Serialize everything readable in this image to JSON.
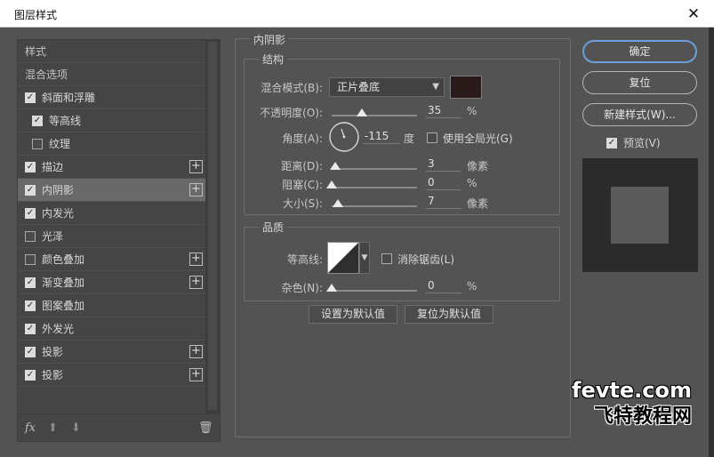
{
  "window": {
    "title": "图层样式",
    "close_glyph": "✕"
  },
  "left_list": {
    "items": [
      {
        "label": "样式",
        "checkbox": null,
        "plus": false,
        "selected": false,
        "indent": false
      },
      {
        "label": "混合选项",
        "checkbox": null,
        "plus": false,
        "selected": false,
        "indent": false
      },
      {
        "label": "斜面和浮雕",
        "checkbox": true,
        "plus": false,
        "selected": false,
        "indent": false
      },
      {
        "label": "等高线",
        "checkbox": true,
        "plus": false,
        "selected": false,
        "indent": true
      },
      {
        "label": "纹理",
        "checkbox": false,
        "plus": false,
        "selected": false,
        "indent": true
      },
      {
        "label": "描边",
        "checkbox": true,
        "plus": true,
        "selected": false,
        "indent": false
      },
      {
        "label": "内阴影",
        "checkbox": true,
        "plus": true,
        "selected": true,
        "indent": false
      },
      {
        "label": "内发光",
        "checkbox": true,
        "plus": false,
        "selected": false,
        "indent": false
      },
      {
        "label": "光泽",
        "checkbox": false,
        "plus": false,
        "selected": false,
        "indent": false
      },
      {
        "label": "颜色叠加",
        "checkbox": false,
        "plus": true,
        "selected": false,
        "indent": false
      },
      {
        "label": "渐变叠加",
        "checkbox": true,
        "plus": true,
        "selected": false,
        "indent": false
      },
      {
        "label": "图案叠加",
        "checkbox": true,
        "plus": false,
        "selected": false,
        "indent": false
      },
      {
        "label": "外发光",
        "checkbox": true,
        "plus": false,
        "selected": false,
        "indent": false
      },
      {
        "label": "投影",
        "checkbox": true,
        "plus": true,
        "selected": false,
        "indent": false
      },
      {
        "label": "投影",
        "checkbox": true,
        "plus": true,
        "selected": false,
        "indent": false
      }
    ],
    "tools": {
      "fx": "fx",
      "up": "⬆",
      "down": "⬇",
      "trash": "🗑"
    }
  },
  "inner_shadow": {
    "group_title": "内阴影",
    "structure": {
      "title": "结构",
      "blend_mode_label": "混合模式(B):",
      "blend_mode_value": "正片叠底",
      "blend_color": "#2b1a1a",
      "opacity_label": "不透明度(O):",
      "opacity_value": "35",
      "opacity_fraction": 0.35,
      "opacity_unit": "%",
      "angle_label": "角度(A):",
      "angle_value": "-115",
      "angle_unit": "度",
      "global_light_label": "使用全局光(G)",
      "global_light_checked": false,
      "distance_label": "距离(D):",
      "distance_value": "3",
      "distance_unit": "像素",
      "choke_label": "阻塞(C):",
      "choke_value": "0",
      "choke_unit": "%",
      "size_label": "大小(S):",
      "size_value": "7",
      "size_unit": "像素"
    },
    "quality": {
      "title": "品质",
      "contour_label": "等高线:",
      "antialias_label": "消除锯齿(L)",
      "antialias_checked": false,
      "noise_label": "杂色(N):",
      "noise_value": "0",
      "noise_unit": "%"
    },
    "make_default_label": "设置为默认值",
    "reset_default_label": "复位为默认值"
  },
  "right": {
    "ok_label": "确定",
    "reset_label": "复位",
    "new_style_label": "新建样式(W)...",
    "preview_label": "预览(V)",
    "preview_checked": true
  },
  "watermark": {
    "line1": "fevte.com",
    "line2": "飞特教程网"
  },
  "colors": {
    "accent": "#6ea0df",
    "dialog_bg": "#535353",
    "selected_row": "#696969"
  }
}
